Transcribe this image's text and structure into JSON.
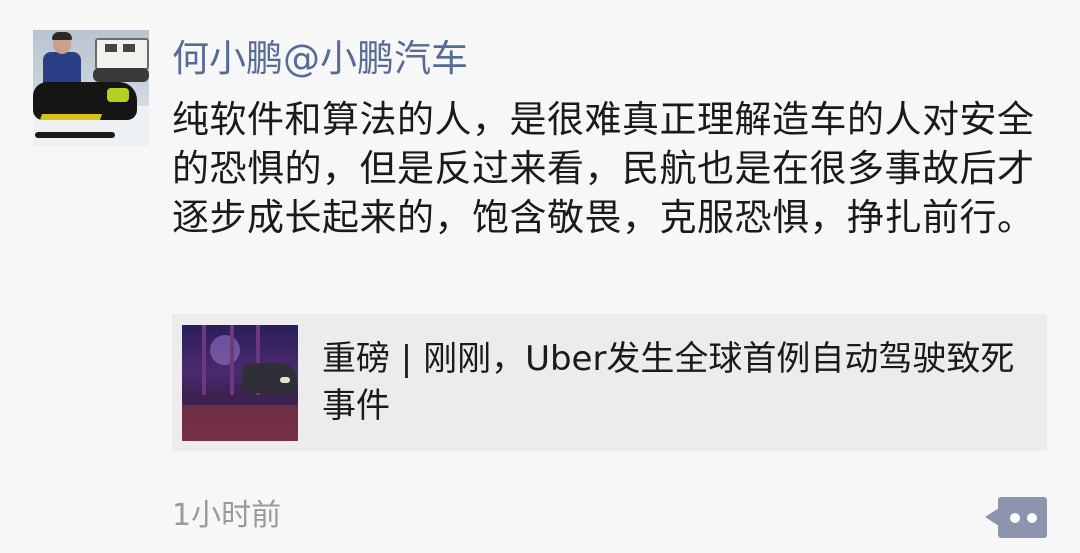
{
  "post": {
    "author": "何小鹏@小鹏汽车",
    "text": "纯软件和算法的人，是很难真正理解造车的人对安全的恐惧的，但是反过来看，民航也是在很多事故后才逐步成长起来的，饱含敬畏，克服恐惧，挣扎前行。",
    "link": {
      "title": "重磅 | 刚刚，Uber发生全球首例自动驾驶致死事件"
    },
    "timestamp": "1小时前"
  },
  "colors": {
    "author_name": "#576b95",
    "background": "#f7f7f7",
    "link_card": "#ececec",
    "comment_button": "#8c95ad",
    "timestamp": "#9a9a9a"
  },
  "icons": {
    "comment_button": "comment-dots-icon"
  }
}
